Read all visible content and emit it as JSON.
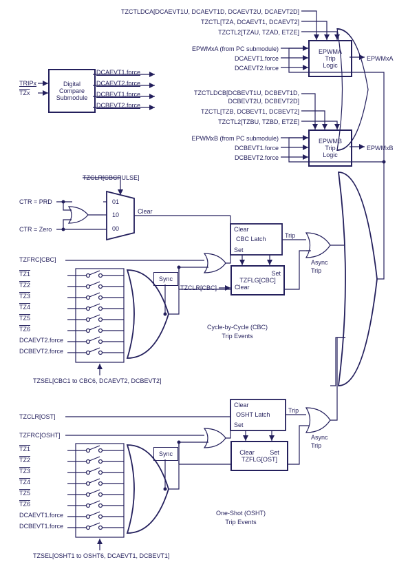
{
  "top": {
    "reg1": "TZCTLDCA[DCAEVT1U, DCAEVT1D, DCAEVT2U, DCAEVT2D]",
    "reg2": "TZCTL[TZA, DCAEVT1, DCAEVT2]",
    "reg3": "TZCTL2[TZAU, TZAD, ETZE]",
    "epwma_src": "EPWMxA (from PC submodule)",
    "dca1f": "DCAEVT1.force",
    "dca2f": "DCAEVT2.force",
    "epwma_box1": "EPWMA",
    "epwma_box2": "Trip",
    "epwma_box3": "Logic",
    "epwma_out": "EPWMxA",
    "reg4": "TZCTLDCB[DCBEVT1U, DCBEVT1D,",
    "reg4b": "DCBEVT2U, DCBEVT2D]",
    "reg5": "TZCTL[TZB, DCBEVT1, DCBEVT2]",
    "reg6": "TZCTL2[TZBU, TZBD, ETZE]",
    "epwmb_src": "EPWMxB (from PC submodule)",
    "dcb1f": "DCBEVT1.force",
    "dcb2f": "DCBEVT2.force",
    "epwmb_box1": "EPWMB",
    "epwmb_box2": "Trip",
    "epwmb_box3": "Logic",
    "epwmb_out": "EPWMxB"
  },
  "dcsub": {
    "tripx": "TRIPx",
    "tzx": "TZx",
    "title1": "Digital",
    "title2": "Compare",
    "title3": "Submodule",
    "out1": "DCAEVT1.force",
    "out2": "DCAEVT2.force",
    "out3": "DCBEVT1.force",
    "out4": "DCBEVT2.force"
  },
  "cbc": {
    "tzclr_pulse": "TZCLR[CBCPULSE]",
    "ctr_prd": "CTR = PRD",
    "ctr_zero": "CTR = Zero",
    "mux01": "01",
    "mux10": "10",
    "mux00": "00",
    "clear_wire": "Clear",
    "tzfrc": "TZFRC[CBC]",
    "sync": "Sync",
    "tzclr": "TZCLR[CBC]",
    "latch": "CBC Latch",
    "latch_clear": "Clear",
    "latch_set": "Set",
    "flg": "TZFLG[CBC]",
    "flg_set": "Set",
    "flg_clear": "Clear",
    "trip": "Trip",
    "async": "Async",
    "async2": "Trip",
    "title1": "Cycle-by-Cycle (CBC)",
    "title2": "Trip Events",
    "tz1": "TZ1",
    "tz2": "TZ2",
    "tz3": "TZ3",
    "tz4": "TZ4",
    "tz5": "TZ5",
    "tz6": "TZ6",
    "dca2f": "DCAEVT2.force",
    "dcb2f": "DCBEVT2.force",
    "tzsel": "TZSEL[CBC1 to CBC6, DCAEVT2, DCBEVT2]"
  },
  "osht": {
    "tzclr": "TZCLR[OST]",
    "tzfrc": "TZFRC[OSHT]",
    "sync": "Sync",
    "latch": "OSHT Latch",
    "latch_clear": "Clear",
    "latch_set": "Set",
    "flg": "TZFLG[OST]",
    "flg_set": "Set",
    "flg_clear": "Clear",
    "trip": "Trip",
    "async": "Async",
    "async2": "Trip",
    "title1": "One-Shot (OSHT)",
    "title2": "Trip Events",
    "tz1": "TZ1",
    "tz2": "TZ2",
    "tz3": "TZ3",
    "tz4": "TZ4",
    "tz5": "TZ5",
    "tz6": "TZ6",
    "dca1f": "DCAEVT1.force",
    "dcb1f": "DCBEVT1.force",
    "tzsel": "TZSEL[OSHT1 to OSHT6, DCAEVT1, DCBEVT1]"
  }
}
